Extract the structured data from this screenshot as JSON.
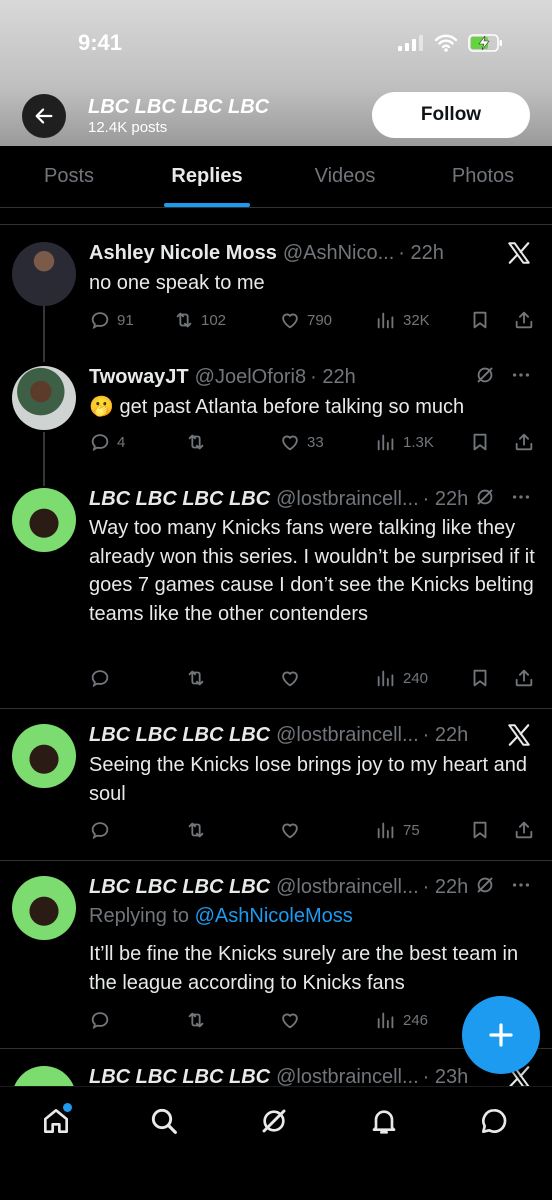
{
  "status_bar": {
    "time": "9:41"
  },
  "profile": {
    "name": "LBC LBC LBC LBC",
    "posts": "12.4K posts",
    "follow_label": "Follow"
  },
  "tabs": [
    {
      "label": "Posts"
    },
    {
      "label": "Replies"
    },
    {
      "label": "Videos"
    },
    {
      "label": "Photos"
    }
  ],
  "tweets": [
    {
      "name": "Ashley Nicole Moss",
      "handle": "@AshNico...",
      "time": "· 22h",
      "text": "no one speak to me",
      "replies": "91",
      "reposts": "102",
      "likes": "790",
      "views": "32K"
    },
    {
      "name": "TwowayJT",
      "handle": "@JoelOfori8",
      "time": "· 22h",
      "text": "🫢 get past Atlanta before talking so much",
      "replies": "4",
      "reposts": "",
      "likes": "33",
      "views": "1.3K"
    },
    {
      "name": "LBC LBC LBC LBC",
      "handle": "@lostbraincell...",
      "time": "· 22h",
      "text": "Way too many Knicks fans were talking like they already won this series. I wouldn’t be surprised if it goes 7 games cause I don’t see the Knicks belting teams like the other contenders",
      "views": "240"
    },
    {
      "name": "LBC LBC LBC LBC",
      "handle": "@lostbraincell...",
      "time": "· 22h",
      "text": "Seeing the Knicks lose brings joy to my heart and soul",
      "views": "75"
    },
    {
      "name": "LBC LBC LBC LBC",
      "handle": "@lostbraincell...",
      "time": "· 22h",
      "replying_prefix": "Replying to ",
      "replying_to": "@AshNicoleMoss",
      "text": "It’ll be fine the Knicks surely are the best team in the league according to Knicks fans",
      "views": "246"
    },
    {
      "name": "LBC LBC LBC LBC",
      "handle": "@lostbraincell...",
      "time": "· 23h"
    }
  ],
  "icons": {
    "back": "arrow-left-icon",
    "more": "more-icon",
    "grok": "grok-icon",
    "x_logo": "x-logo-icon",
    "reply": "reply-icon",
    "repost": "repost-icon",
    "like": "like-icon",
    "views": "views-icon",
    "bookmark": "bookmark-icon",
    "share": "share-icon",
    "compose": "compose-icon",
    "home": "home-icon",
    "search": "search-icon",
    "notifications": "bell-icon",
    "messages": "messages-icon"
  },
  "colors": {
    "accent": "#1d9bf0",
    "muted": "#71767b",
    "text": "#e7e9ea",
    "bg": "#000000"
  }
}
